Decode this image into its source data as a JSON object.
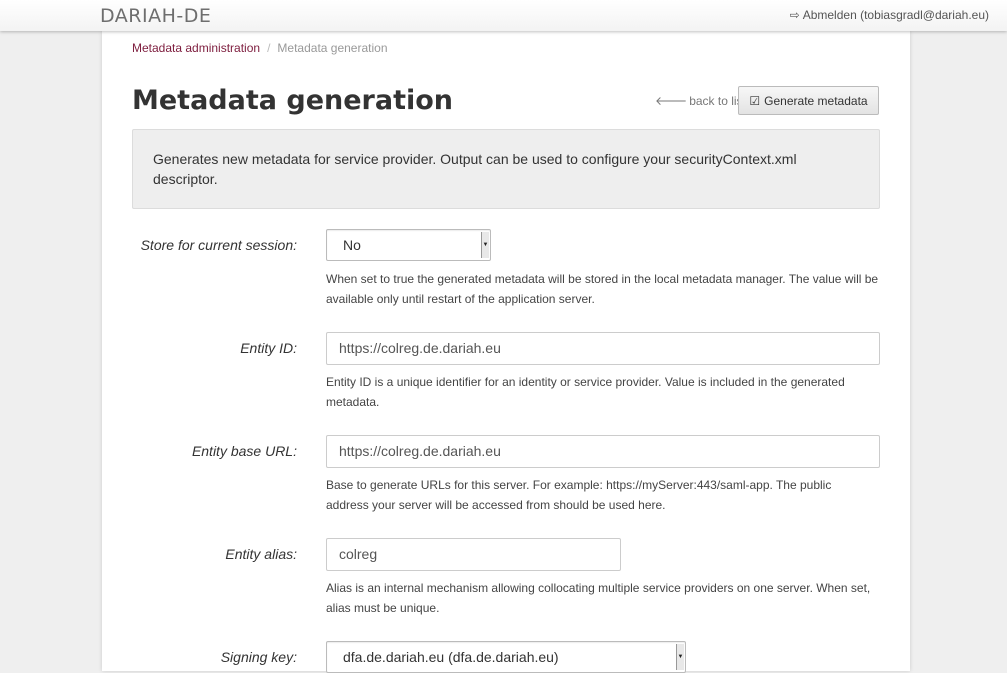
{
  "header": {
    "brand": "DARIAH-DE",
    "logout_icon": "sign-out-icon",
    "logout_label": "Abmelden (tobiasgradl@dariah.eu)"
  },
  "breadcrumb": {
    "parent": "Metadata administration",
    "separator": "/",
    "current": "Metadata generation"
  },
  "page": {
    "title": "Metadata generation",
    "back_icon": "arrow-left-icon",
    "back_label": "back to list",
    "generate_icon": "check-square-icon",
    "generate_label": "Generate metadata",
    "info_text": "Generates new metadata for service provider. Output can be used to configure your securityContext.xml descriptor."
  },
  "form": {
    "store": {
      "label": "Store for current session:",
      "value": "No",
      "help": "When set to true the generated metadata will be stored in the local metadata manager. The value will be available only until restart of the application server."
    },
    "entity_id": {
      "label": "Entity ID:",
      "value": "https://colreg.de.dariah.eu",
      "help": "Entity ID is a unique identifier for an identity or service provider. Value is included in the generated metadata."
    },
    "entity_base_url": {
      "label": "Entity base URL:",
      "value": "https://colreg.de.dariah.eu",
      "help": "Base to generate URLs for this server. For example: https://myServer:443/saml-app. The public address your server will be accessed from should be used here."
    },
    "entity_alias": {
      "label": "Entity alias:",
      "value": "colreg",
      "help": "Alias is an internal mechanism allowing collocating multiple service providers on one server. When set, alias must be unique."
    },
    "signing_key": {
      "label": "Signing key:",
      "value": "dfa.de.dariah.eu (dfa.de.dariah.eu)"
    }
  },
  "colors": {
    "link": "#7d1c3d",
    "background": "#efefef",
    "panel": "#ffffff",
    "info_box": "#eeeeee"
  }
}
